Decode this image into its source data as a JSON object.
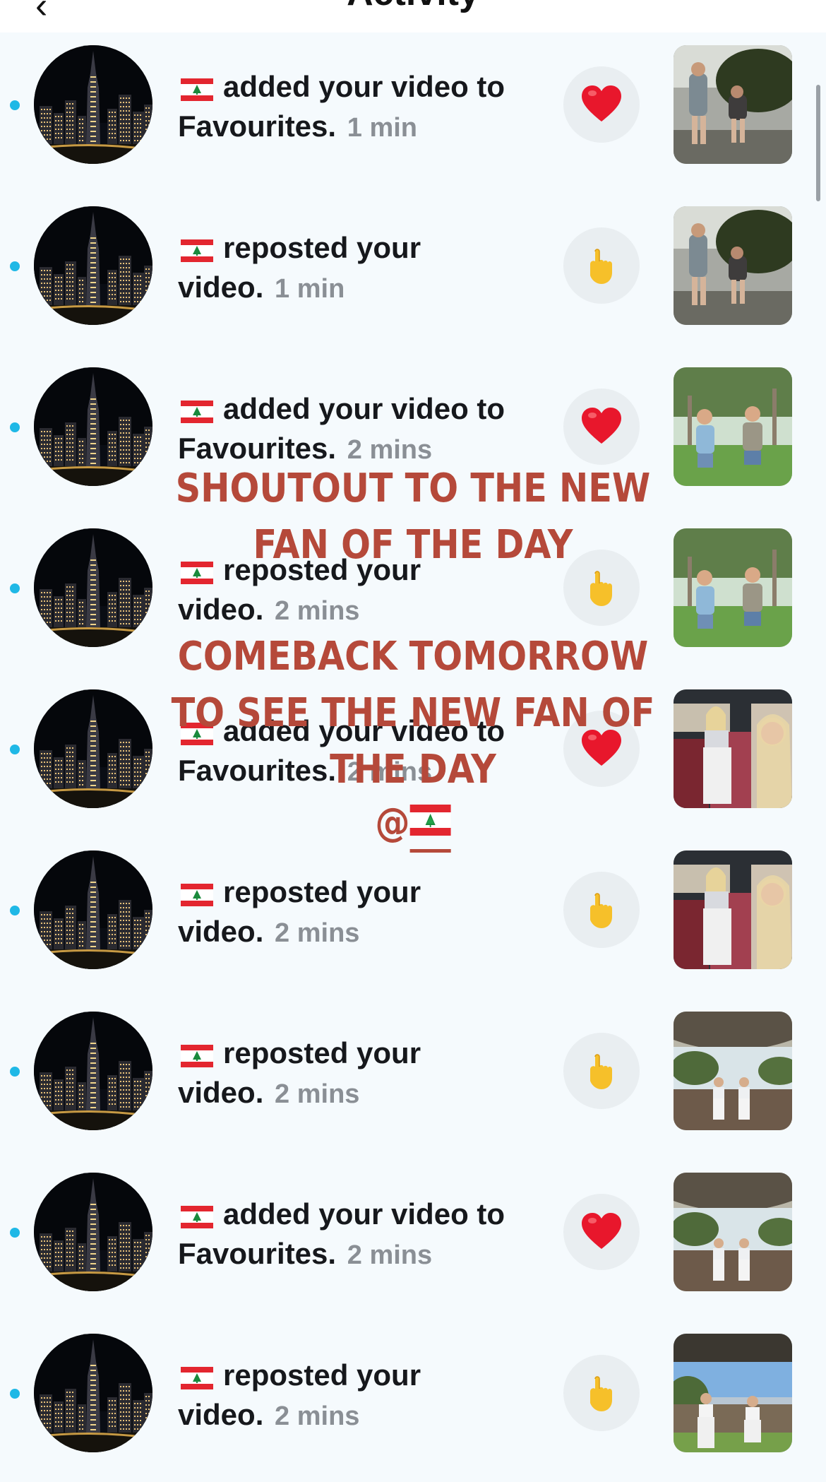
{
  "header": {
    "back_icon": "‹",
    "title": "Activity"
  },
  "rows": [
    {
      "action": "added your video to",
      "action2": "Favourites.",
      "time": "1 min",
      "reaction": "heart",
      "thumb": "park-evening"
    },
    {
      "action": "reposted your",
      "action2": "video.",
      "time": "1 min",
      "reaction": "pointing-hand",
      "thumb": "park-evening"
    },
    {
      "action": "added your video to",
      "action2": "Favourites.",
      "time": "2 mins",
      "reaction": "heart",
      "thumb": "grass-field"
    },
    {
      "action": "reposted your",
      "action2": "video.",
      "time": "2 mins",
      "reaction": "pointing-hand",
      "thumb": "grass-field"
    },
    {
      "action": "added your video to",
      "action2": "Favourites.",
      "time": "2 mins",
      "reaction": "heart",
      "thumb": "bus-interior"
    },
    {
      "action": "reposted your",
      "action2": "video.",
      "time": "2 mins",
      "reaction": "pointing-hand",
      "thumb": "bus-interior"
    },
    {
      "action": "reposted your",
      "action2": "video.",
      "time": "2 mins",
      "reaction": "pointing-hand",
      "thumb": "backyard-tent"
    },
    {
      "action": "added your video to",
      "action2": "Favourites.",
      "time": "2 mins",
      "reaction": "heart",
      "thumb": "backyard-tent"
    },
    {
      "action": "reposted your",
      "action2": "video.",
      "time": "2 mins",
      "reaction": "pointing-hand",
      "thumb": "backyard-fence"
    }
  ],
  "overlay": {
    "line1": "SHOUTOUT TO THE NEW FAN OF THE DAY",
    "line2": "COMEBACK TOMORROW TO SEE THE NEW FAN OF THE DAY",
    "line3_prefix": "@"
  },
  "colors": {
    "accent_dot": "#1fb8e6",
    "overlay_text": "#b5493a",
    "heart": "#e8172c",
    "hand": "#f6c02a"
  },
  "icons": {
    "heart": "heart-icon",
    "pointing-hand": "pointing-hand-icon",
    "flag": "lebanon-flag-icon"
  }
}
